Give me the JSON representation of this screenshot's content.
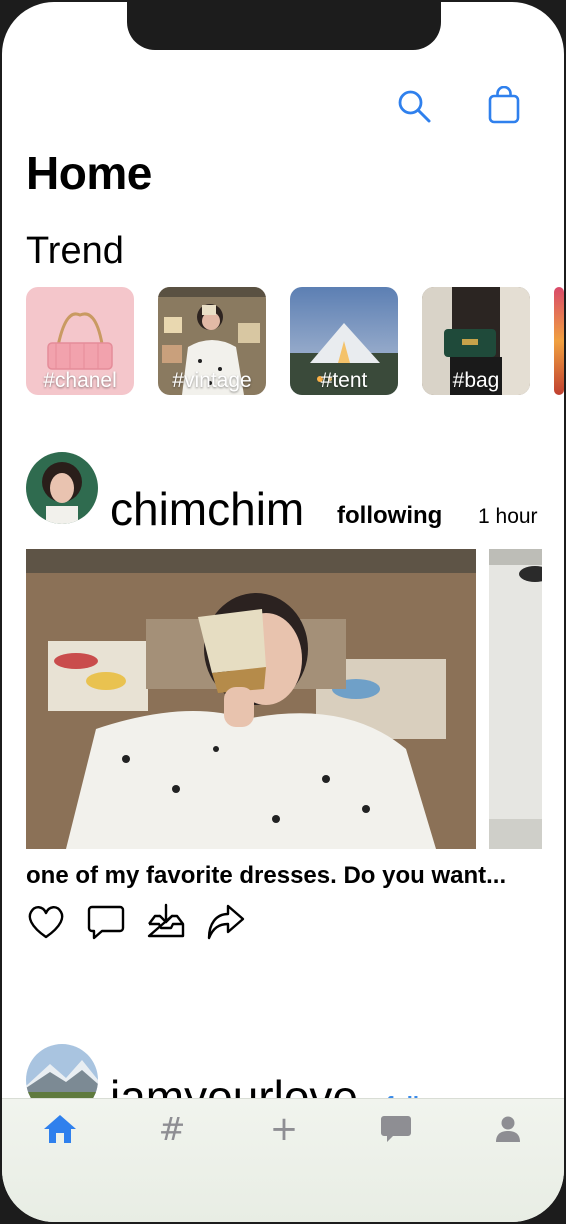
{
  "header": {
    "title": "Home",
    "search_icon": "search-icon",
    "bag_icon": "shopping-bag-icon",
    "accent_color": "#2f80ed"
  },
  "trend": {
    "title": "Trend",
    "items": [
      {
        "label": "#chanel"
      },
      {
        "label": "#vintage"
      },
      {
        "label": "#tent"
      },
      {
        "label": "#bag"
      }
    ]
  },
  "posts": [
    {
      "username": "chimchim",
      "follow_status": "following",
      "time": "1 hour",
      "caption": "one of my favorite dresses. Do you want...",
      "actions": [
        "heart-icon",
        "comment-icon",
        "save-icon",
        "share-icon"
      ]
    },
    {
      "username": "iamyourlove",
      "follow_status": "follow"
    }
  ],
  "tabbar": {
    "items": [
      "home-icon",
      "hashtag-icon",
      "plus-icon",
      "chat-icon",
      "profile-icon"
    ],
    "hash_glyph": "#",
    "plus_glyph": "+",
    "active_color": "#2f80ed",
    "inactive_color": "#8e8e93"
  }
}
